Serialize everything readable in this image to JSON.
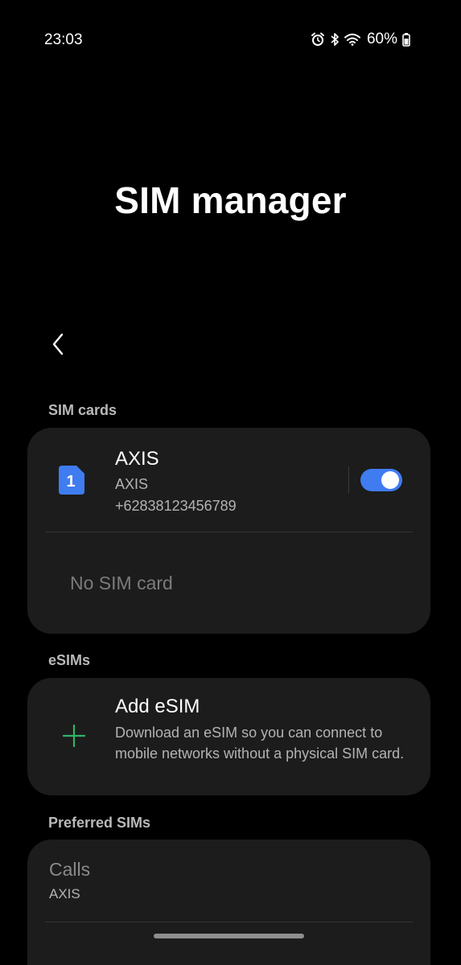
{
  "status_bar": {
    "time": "23:03",
    "battery": "60%",
    "icons": [
      "alarm-icon",
      "bluetooth-icon",
      "wifi-icon",
      "battery-icon"
    ]
  },
  "header": {
    "title": "SIM manager"
  },
  "sections": {
    "sim_cards": "SIM cards",
    "esims": "eSIMs",
    "preferred": "Preferred SIMs"
  },
  "sim1": {
    "slot": "1",
    "name": "AXIS",
    "carrier": "AXIS",
    "number": "+62838123456789",
    "enabled": true
  },
  "sim2": {
    "label": "No SIM card"
  },
  "esim": {
    "title": "Add eSIM",
    "description": "Download an eSIM so you can connect to mobile networks without a physical SIM card."
  },
  "preferred": {
    "calls_label": "Calls",
    "calls_value": "AXIS"
  },
  "colors": {
    "background": "#000000",
    "card": "#1c1c1c",
    "accent_blue": "#3f7cf0",
    "accent_green": "#2fb46a"
  }
}
